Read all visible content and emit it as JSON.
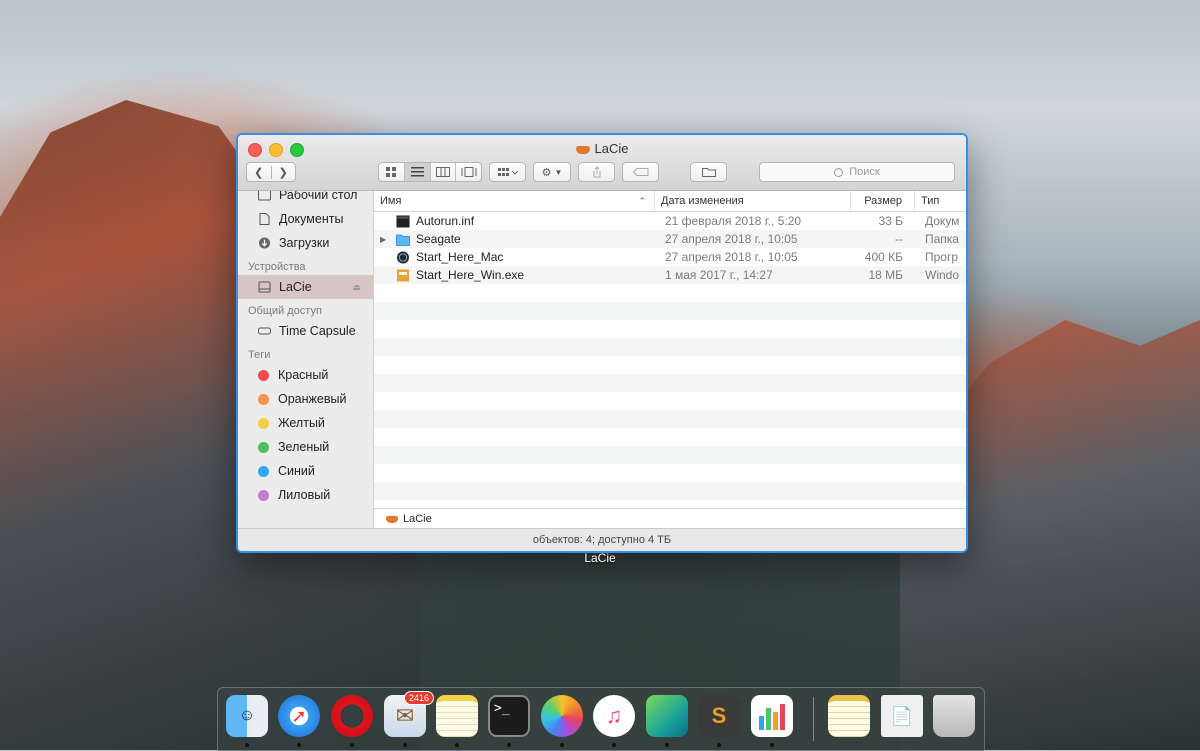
{
  "window": {
    "title": "LaCie",
    "toolbar": {
      "search_placeholder": "Поиск"
    },
    "sidebar": {
      "items_top": [
        {
          "label": "Рабочий стол",
          "icon": "desktop-icon"
        },
        {
          "label": "Документы",
          "icon": "documents-icon"
        },
        {
          "label": "Загрузки",
          "icon": "downloads-icon"
        }
      ],
      "devices_header": "Устройства",
      "device": {
        "label": "LaCie",
        "icon": "drive-icon"
      },
      "shared_header": "Общий доступ",
      "shared": {
        "label": "Time Capsule",
        "icon": "time-capsule-icon"
      },
      "tags_header": "Теги",
      "tags": [
        {
          "label": "Красный",
          "color": "#f24b4b"
        },
        {
          "label": "Оранжевый",
          "color": "#f5934a"
        },
        {
          "label": "Желтый",
          "color": "#f5cc4a"
        },
        {
          "label": "Зеленый",
          "color": "#4ec25a"
        },
        {
          "label": "Синий",
          "color": "#2ea8f0"
        },
        {
          "label": "Лиловый",
          "color": "#c47ad6"
        }
      ]
    },
    "columns": {
      "name": "Имя",
      "date": "Дата изменения",
      "size": "Размер",
      "kind": "Тип"
    },
    "files": [
      {
        "name": "Autorun.inf",
        "date": "21 февраля 2018 г., 5:20",
        "size": "33 Б",
        "kind": "Докум",
        "icon": "document-icon"
      },
      {
        "name": "Seagate",
        "date": "27 апреля 2018 г., 10:05",
        "size": "--",
        "kind": "Папка",
        "icon": "folder-icon"
      },
      {
        "name": "Start_Here_Mac",
        "date": "27 апреля 2018 г., 10:05",
        "size": "400 КБ",
        "kind": "Прогр",
        "icon": "mac-app-icon"
      },
      {
        "name": "Start_Here_Win.exe",
        "date": "1 мая 2017 г., 14:27",
        "size": "18 МБ",
        "kind": "Windo",
        "icon": "exe-icon"
      }
    ],
    "path": "LaCie",
    "status": "объектов: 4; доступно 4 ТБ"
  },
  "desktop_label": "LaCie",
  "dock": {
    "mail_badge": "2416",
    "apps": [
      "Finder",
      "Safari",
      "Opera",
      "Mail",
      "Notes",
      "Terminal",
      "Photos",
      "iTunes",
      "App",
      "Sublime Text",
      "Numbers"
    ]
  }
}
